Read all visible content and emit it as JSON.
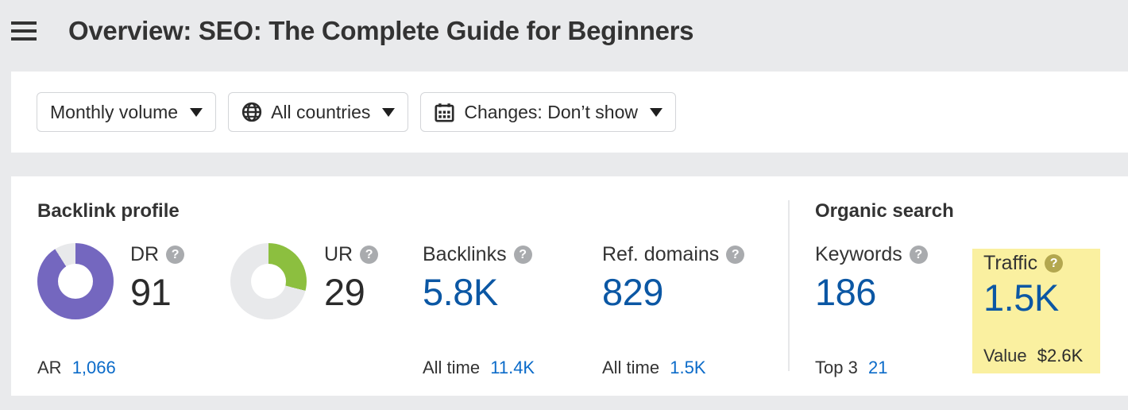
{
  "header": {
    "menu_icon": "hamburger-menu-icon",
    "title": "Overview: SEO: The Complete Guide for Beginners"
  },
  "filters": [
    {
      "id": "metric-mode",
      "label": "Monthly volume",
      "icon": null,
      "caret": true
    },
    {
      "id": "country",
      "label": "All countries",
      "icon": "globe-icon",
      "caret": true
    },
    {
      "id": "changes",
      "label": "Changes: Don’t show",
      "icon": "calendar-icon",
      "caret": true
    }
  ],
  "backlink_profile": {
    "title": "Backlink profile",
    "dr": {
      "label": "DR",
      "value": "91",
      "percent": 91,
      "color": "#7467bf",
      "track": "#e8e9eb",
      "help": "?",
      "sub_label": "AR",
      "sub_value": "1,066"
    },
    "ur": {
      "label": "UR",
      "value": "29",
      "percent": 29,
      "color": "#8cbf3f",
      "track": "#e8e9eb",
      "help": "?"
    },
    "backlinks": {
      "label": "Backlinks",
      "value": "5.8K",
      "help": "?",
      "sub_label": "All time",
      "sub_value": "11.4K"
    },
    "ref_domains": {
      "label": "Ref. domains",
      "value": "829",
      "help": "?",
      "sub_label": "All time",
      "sub_value": "1.5K"
    }
  },
  "organic_search": {
    "title": "Organic search",
    "keywords": {
      "label": "Keywords",
      "value": "186",
      "help": "?",
      "sub_label": "Top 3",
      "sub_value": "21"
    },
    "traffic": {
      "label": "Traffic",
      "value": "1.5K",
      "help": "?",
      "sub_label": "Value",
      "sub_value": "$2.6K",
      "highlight_color": "#faf0a0"
    }
  },
  "colors": {
    "page_background": "#e9eaec",
    "card_background": "#ffffff",
    "value_blue": "#0b57a4",
    "link_blue": "#0b6bc9",
    "text_dark": "#333333"
  }
}
